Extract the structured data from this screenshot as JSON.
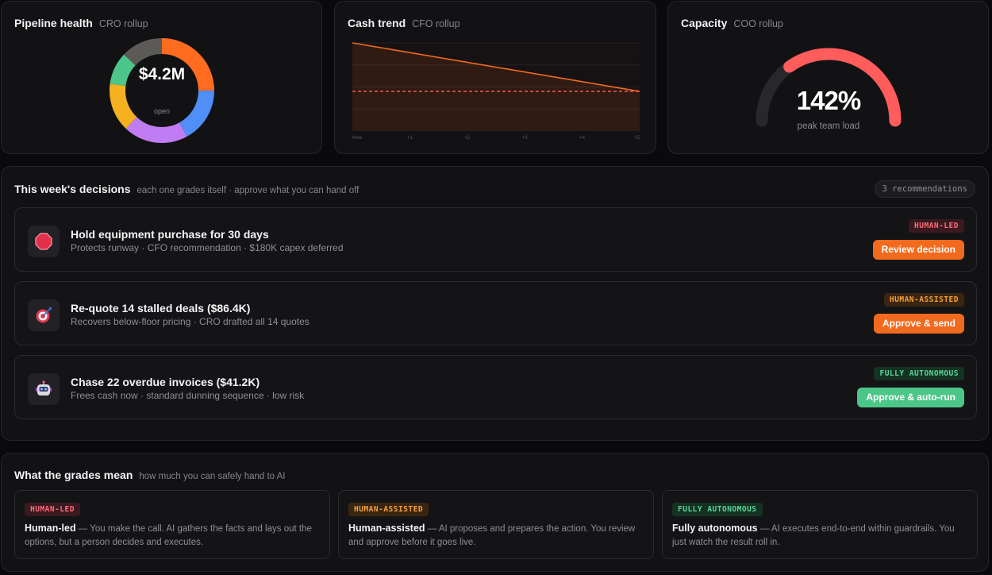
{
  "pipeline": {
    "title": "Pipeline health",
    "subtitle": "CRO rollup",
    "value": "$4.2M",
    "value_label": "open",
    "segments": [
      {
        "color": "#ff6b1f",
        "fraction": 0.25
      },
      {
        "color": "#4f8ff7",
        "fraction": 0.17
      },
      {
        "color": "#c07cf2",
        "fraction": 0.2
      },
      {
        "color": "#f5b020",
        "fraction": 0.15
      },
      {
        "color": "#4cc688",
        "fraction": 0.1
      },
      {
        "color": "#5c5a56",
        "fraction": 0.13
      }
    ]
  },
  "cash": {
    "title": "Cash trend",
    "subtitle": "CFO rollup",
    "ticks": [
      "Now",
      "+1",
      "+2",
      "+3",
      "+4",
      "+5"
    ],
    "line_start": 1.0,
    "line_end": 0.45,
    "threshold": 0.45,
    "line_color": "#f26a1e",
    "threshold_color": "#ff5a5a"
  },
  "capacity": {
    "title": "Capacity",
    "subtitle": "COO rollup",
    "value": "142%",
    "label": "peak team load",
    "fill_fraction": 0.7,
    "fill_color": "#ff5c5c",
    "track_color": "#27272c"
  },
  "decisions": {
    "title": "This week's decisions",
    "subtitle": "each one grades itself · approve what you can hand off",
    "count_badge": "3 recommendations",
    "items": [
      {
        "icon": "stop-icon",
        "title": "Hold equipment purchase for 30 days",
        "desc": "Protects runway · CFO recommendation · $180K capex deferred",
        "tag": "HUMAN-LED",
        "button": "Review decision"
      },
      {
        "icon": "target-icon",
        "title": "Re-quote 14 stalled deals ($86.4K)",
        "desc": "Recovers below-floor pricing · CRO drafted all 14 quotes",
        "tag": "HUMAN-ASSISTED",
        "button": "Approve & send"
      },
      {
        "icon": "robot-icon",
        "title": "Chase 22 overdue invoices ($41.2K)",
        "desc": "Frees cash now · standard dunning sequence · low risk",
        "tag": "FULLY AUTONOMOUS",
        "button": "Approve & auto-run"
      }
    ]
  },
  "grades": {
    "title": "What the grades mean",
    "subtitle": "how much you can safely hand to AI",
    "items": [
      {
        "tag": "HUMAN-LED",
        "name": "Human-led",
        "text": " — You make the call. AI gathers the facts and lays out the options, but a person decides and executes."
      },
      {
        "tag": "HUMAN-ASSISTED",
        "name": "Human-assisted",
        "text": " — AI proposes and prepares the action. You review and approve before it goes live."
      },
      {
        "tag": "FULLY AUTONOMOUS",
        "name": "Fully autonomous",
        "text": " — AI executes end-to-end within guardrails. You just watch the result roll in."
      }
    ]
  }
}
